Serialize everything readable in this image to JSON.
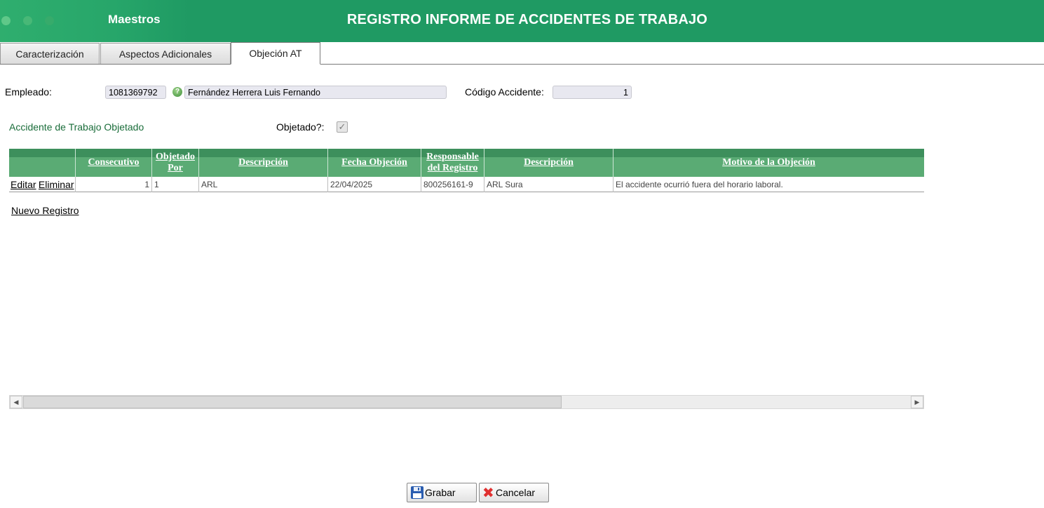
{
  "header": {
    "section": "Maestros",
    "title": "REGISTRO INFORME DE ACCIDENTES DE TRABAJO"
  },
  "tabs": [
    {
      "label": "Caracterización"
    },
    {
      "label": "Aspectos Adicionales"
    },
    {
      "label": "Objeción AT",
      "active": true
    }
  ],
  "form": {
    "employee_label": "Empleado:",
    "employee_id": "1081369792",
    "employee_name": "Fernández Herrera Luis Fernando",
    "accident_code_label": "Código Accidente:",
    "accident_code": "1",
    "section_label": "Accidente de Trabajo Objetado",
    "objected_label": "Objetado?:",
    "objected_checked": true
  },
  "grid": {
    "columns": [
      "",
      "Consecutivo",
      "Objetado Por",
      "Descripción",
      "Fecha Objeción",
      "Responsable del Registro",
      "Descripción",
      "Motivo de la Objeción"
    ],
    "rows": [
      {
        "edit": "Editar",
        "delete": "Eliminar",
        "consecutivo": "1",
        "objetado_por": "1",
        "descripcion": "ARL",
        "fecha": "22/04/2025",
        "responsable": "800256161-9",
        "descripcion2": "ARL Sura",
        "motivo": "El accidente ocurrió fuera del horario laboral."
      }
    ],
    "new_record": "Nuevo Registro"
  },
  "buttons": {
    "save": "Grabar",
    "cancel": "Cancelar"
  },
  "colors": {
    "header": "#1f9a63",
    "grid_header": "#5aab74",
    "section_label": "#1a6d3a"
  }
}
